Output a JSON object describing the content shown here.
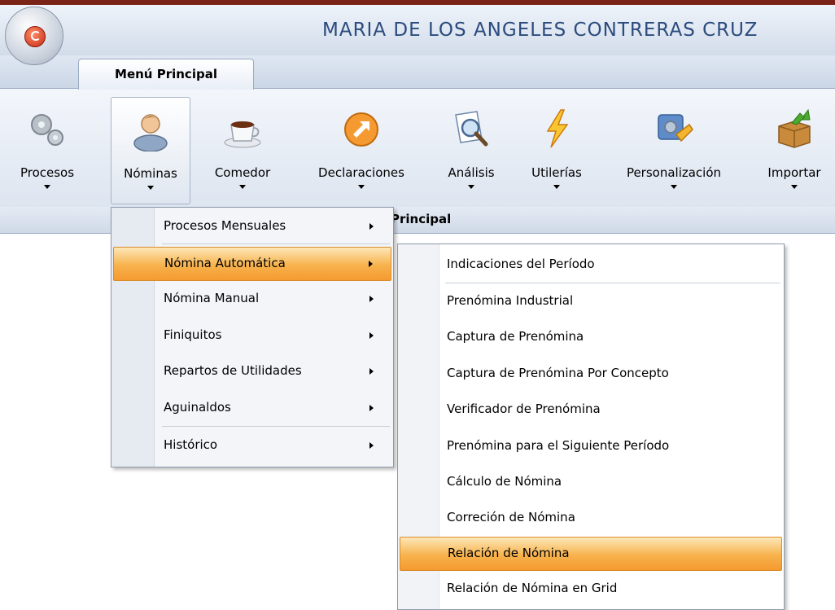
{
  "window": {
    "title": "MARIA DE LOS ANGELES CONTRERAS CRUZ"
  },
  "tabs": [
    {
      "label": "Menú Principal"
    }
  ],
  "ribbon": {
    "group_title": "Principal",
    "buttons": [
      {
        "label": "Procesos",
        "icon": "gears-icon"
      },
      {
        "label": "Nóminas",
        "icon": "person-icon"
      },
      {
        "label": "Comedor",
        "icon": "coffee-cup-icon"
      },
      {
        "label": "Declaraciones",
        "icon": "orange-arrow-icon"
      },
      {
        "label": "Análisis",
        "icon": "magnifier-document-icon"
      },
      {
        "label": "Utilerías",
        "icon": "lightning-icon"
      },
      {
        "label": "Personalización",
        "icon": "settings-tools-icon"
      },
      {
        "label": "Importar",
        "icon": "import-box-icon"
      }
    ]
  },
  "nominas_menu": [
    {
      "label": "Procesos Mensuales",
      "submenu": true
    },
    {
      "label": "Nómina Automática",
      "submenu": true,
      "highlighted": true
    },
    {
      "label": "Nómina Manual",
      "submenu": true
    },
    {
      "label": "Finiquitos",
      "submenu": true
    },
    {
      "label": "Repartos de Utilidades",
      "submenu": true
    },
    {
      "label": "Aguinaldos",
      "submenu": true
    },
    {
      "label": "Histórico",
      "submenu": true
    }
  ],
  "nomina_automatica_menu": [
    {
      "label": "Indicaciones del Período"
    },
    {
      "label": "Prenómina Industrial"
    },
    {
      "label": "Captura de Prenómina"
    },
    {
      "label": "Captura de Prenómina Por Concepto"
    },
    {
      "label": "Verificador de Prenómina"
    },
    {
      "label": "Prenómina para el Siguiente Período"
    },
    {
      "label": "Cálculo de Nómina"
    },
    {
      "label": "Correción de Nómina"
    },
    {
      "label": "Relación de Nómina",
      "highlighted": true
    },
    {
      "label": "Relación de Nómina en Grid"
    }
  ],
  "colors": {
    "highlight": "#f7b24c",
    "title_text": "#2b4b7d",
    "ribbon_bg": "#dde5f0"
  }
}
